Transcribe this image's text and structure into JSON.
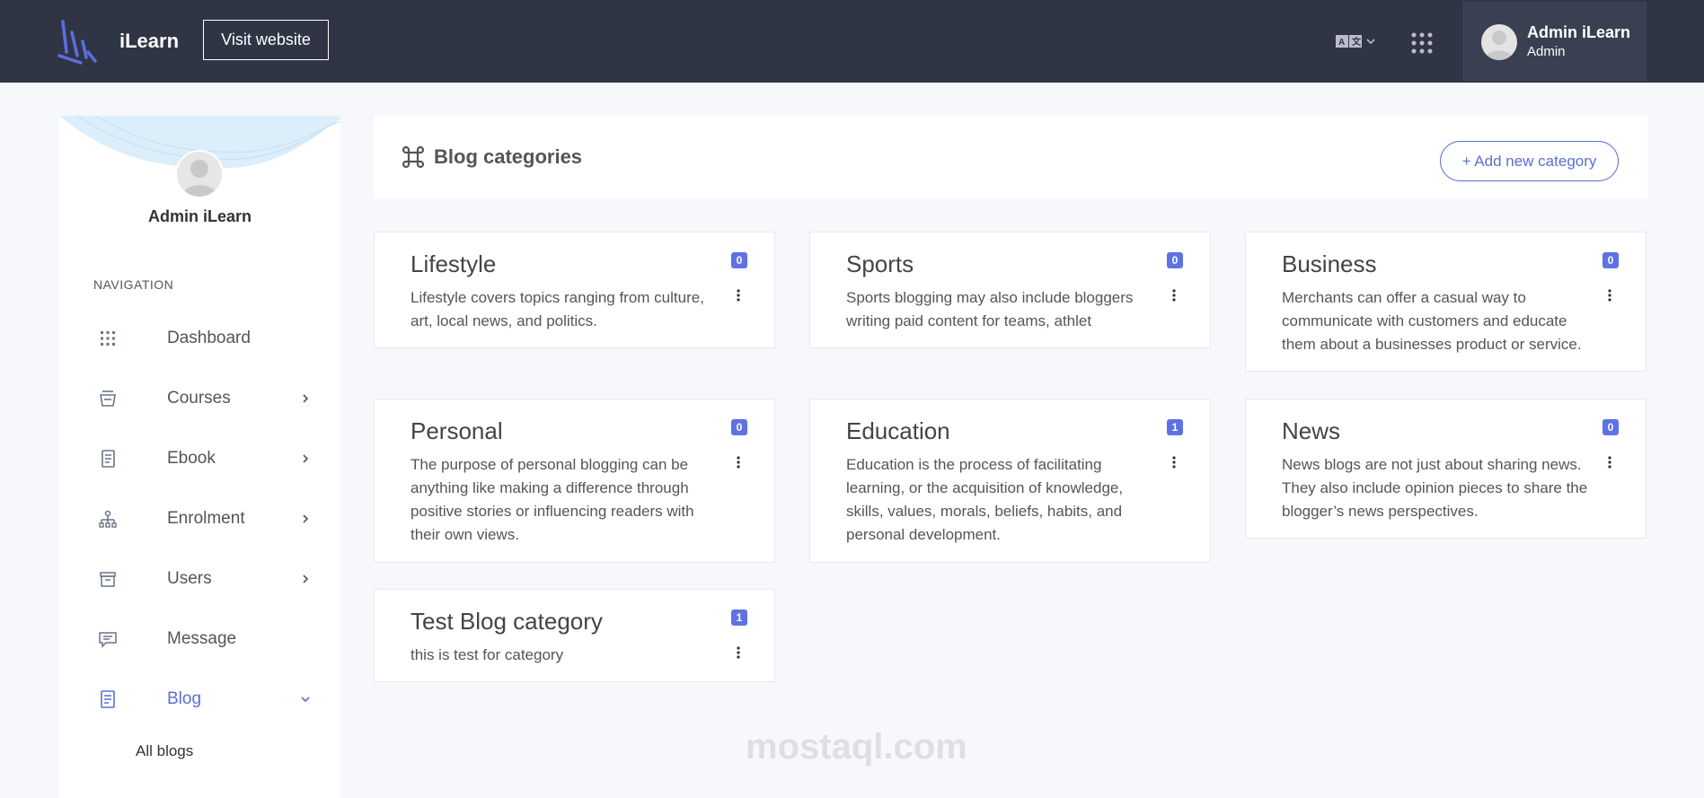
{
  "header": {
    "brand": "iLearn",
    "visit_button": "Visit website",
    "user_name": "Admin iLearn",
    "user_role": "Admin",
    "colors": {
      "bg": "#2f3545",
      "user_box": "#3a4052"
    },
    "icons": [
      "ilearn-logo",
      "translate-icon",
      "chevron-down-icon",
      "apps-grid-icon"
    ]
  },
  "sidebar": {
    "user_name": "Admin iLearn",
    "nav_label": "NAVIGATION",
    "items": [
      {
        "label": "Dashboard",
        "icon": "grid-icon",
        "has_children": false
      },
      {
        "label": "Courses",
        "icon": "courses-icon",
        "has_children": true
      },
      {
        "label": "Ebook",
        "icon": "book-icon",
        "has_children": true
      },
      {
        "label": "Enrolment",
        "icon": "hierarchy-icon",
        "has_children": true
      },
      {
        "label": "Users",
        "icon": "archive-icon",
        "has_children": true
      },
      {
        "label": "Message",
        "icon": "message-icon",
        "has_children": false
      },
      {
        "label": "Blog",
        "icon": "document-icon",
        "has_children": true,
        "active": true
      }
    ],
    "sub_items": [
      "All blogs"
    ],
    "accent": "#5a6fd8"
  },
  "main": {
    "title": "Blog categories",
    "add_button": "+ Add new category",
    "categories": [
      {
        "title": "Lifestyle",
        "count": "0",
        "description": "Lifestyle covers topics ranging from culture, art, local news, and politics."
      },
      {
        "title": "Sports",
        "count": "0",
        "description": "Sports blogging may also include bloggers writing paid content for teams, athlet"
      },
      {
        "title": "Business",
        "count": "0",
        "description": "Merchants can offer a casual way to communicate with customers and educate them about a businesses product or service."
      },
      {
        "title": "Personal",
        "count": "0",
        "description": "The purpose of personal blogging can be anything like making a difference through positive stories or influencing readers with their own views."
      },
      {
        "title": "Education",
        "count": "1",
        "description": "Education is the process of facilitating learning, or the acquisition of knowledge, skills, values, morals, beliefs, habits, and personal development."
      },
      {
        "title": "News",
        "count": "0",
        "description": "News blogs are not just about sharing news. They also include opinion pieces to share the blogger’s news perspectives."
      },
      {
        "title": "Test Blog category",
        "count": "1",
        "description": "this is test for category"
      }
    ],
    "badge_color": "#5f72e4"
  },
  "watermark": {
    "text": "mostaql.com"
  }
}
